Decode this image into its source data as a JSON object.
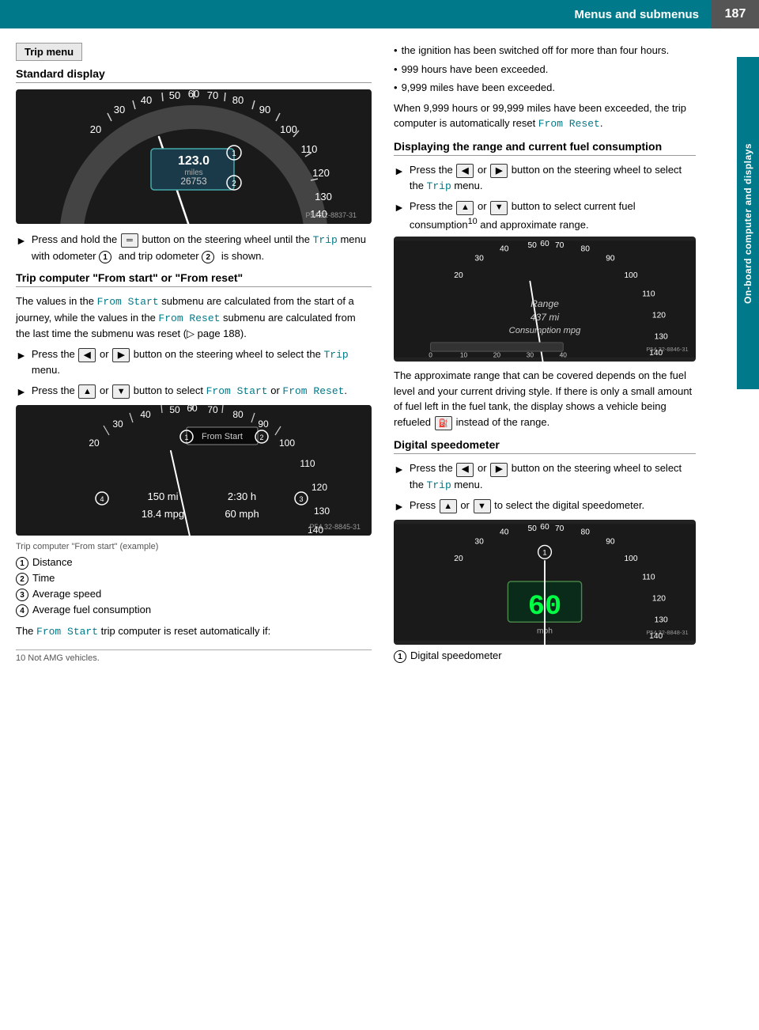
{
  "header": {
    "title": "Menus and submenus",
    "page": "187"
  },
  "sidebar": {
    "label": "On-board computer and displays"
  },
  "left": {
    "trip_menu_label": "Trip menu",
    "standard_display_title": "Standard display",
    "standard_display_img_code": "P54.32-8837-31",
    "press_hold_text": "Press and hold the",
    "press_hold_text2": "button on the steering wheel until the",
    "press_hold_code": "Trip",
    "press_hold_text3": "menu with odometer",
    "press_hold_text4": "and trip odometer",
    "press_hold_text5": "is shown.",
    "trip_computer_title": "Trip computer \"From start\" or \"From reset\"",
    "trip_values_text": "The values in the",
    "from_start_code": "From Start",
    "trip_values_text2": "submenu are calculated from the start of a journey, while the values in the",
    "from_reset_code": "From Reset",
    "trip_values_text3": "submenu are calculated from the last time the submenu was reset (▷ page 188).",
    "press_left_right_1": "Press the",
    "or_1": "or",
    "button_steering_1": "button on the steering wheel to select the",
    "trip_code_1": "Trip",
    "menu_1": "menu.",
    "press_up_down_1": "Press the",
    "or_2": "or",
    "button_select_1": "button to select",
    "from_start_code2": "From Start",
    "or_3": "or",
    "from_reset_code2": "From Reset",
    "period": ".",
    "trip_img_code": "P54.32-8845-31",
    "trip_caption": "Trip computer \"From start\" (example)",
    "items": [
      {
        "num": "1",
        "label": "Distance"
      },
      {
        "num": "2",
        "label": "Time"
      },
      {
        "num": "3",
        "label": "Average speed"
      },
      {
        "num": "4",
        "label": "Average fuel consumption"
      }
    ],
    "from_start_reset_text": "The",
    "from_start_code3": "From Start",
    "reset_text": "trip computer is reset automatically if:",
    "footnote": "10 Not AMG vehicles."
  },
  "right": {
    "bullet_items": [
      "the ignition has been switched off for more than four hours.",
      "999 hours have been exceeded.",
      "9,999 miles have been exceeded."
    ],
    "when_exceeded_text": "When 9,999 hours or 99,999 miles have been exceeded, the trip computer is automatically reset",
    "from_reset_code": "From Reset",
    "period": ".",
    "displaying_title": "Displaying the range and current fuel consumption",
    "press_left_right_2": "Press the",
    "or_4": "or",
    "button_steering_2": "button on the steering wheel to select the",
    "trip_code_2": "Trip",
    "menu_2": "menu.",
    "press_up_down_2": "Press the",
    "or_5": "or",
    "button_select_2": "button to select current fuel consumption",
    "superscript": "10",
    "and_approx": "and approximate range.",
    "range_img_code": "P54.32-8846-31",
    "range_text": "The approximate range that can be covered depends on the fuel level and your current driving style. If there is only a small amount of fuel left in the fuel tank, the display shows a vehicle being refueled",
    "instead_text": "instead of the range.",
    "digital_speedometer_title": "Digital speedometer",
    "press_left_right_3": "Press the",
    "or_6": "or",
    "button_steering_3": "button on the steering wheel to select the",
    "trip_code_3": "Trip",
    "menu_3": "menu.",
    "press_text": "Press",
    "or_7": "or",
    "select_digital": "to select the digital speedometer.",
    "digital_img_code": "P54.32-8848-31",
    "digital_caption": "Digital speedometer",
    "digital_num": "1"
  }
}
